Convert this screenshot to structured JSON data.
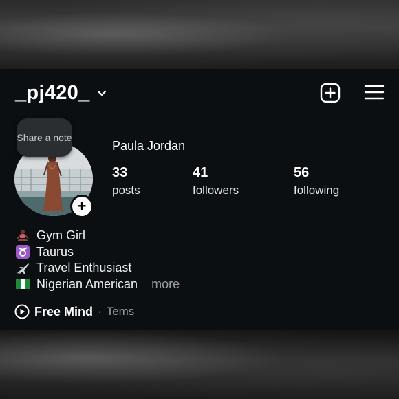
{
  "profile": {
    "username": "_pj420_",
    "display_name": "Paula Jordan",
    "note_prompt": "Share a note",
    "add_story_symbol": "+"
  },
  "stats": {
    "posts": {
      "value": "33",
      "label": "posts"
    },
    "followers": {
      "value": "41",
      "label": "followers"
    },
    "following": {
      "value": "56",
      "label": "following"
    }
  },
  "bio": {
    "lines": [
      {
        "icon": "meditation-emoji",
        "text": "Gym Girl"
      },
      {
        "icon": "taurus-emoji",
        "text": "Taurus"
      },
      {
        "icon": "airplane-emoji",
        "text": "Travel Enthusiast"
      },
      {
        "icon": "nigeria-flag-emoji",
        "text": "Nigerian American"
      }
    ],
    "more_label": "more"
  },
  "music": {
    "icon": "play-circle-icon",
    "song": "Free Mind",
    "separator": "·",
    "artist": "Tems"
  },
  "header_icons": [
    "chevron-down-icon",
    "add-post-icon",
    "hamburger-menu-icon"
  ],
  "colors": {
    "panel_bg": "#0b0f12",
    "text_primary": "#ffffff",
    "text_secondary": "#9a9ea2",
    "taurus_badge": "#9b59c8",
    "note_bubble": "#2a2d31"
  }
}
